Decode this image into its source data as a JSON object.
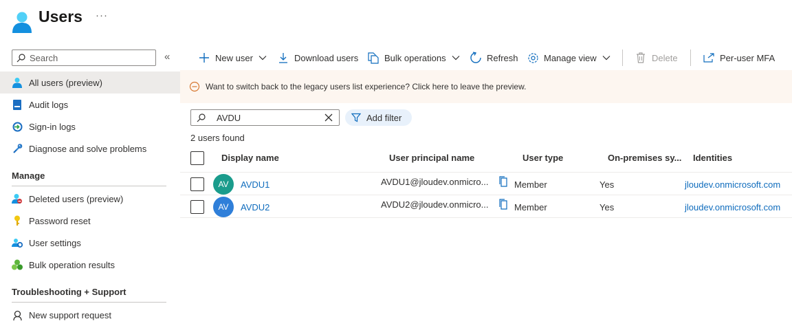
{
  "header": {
    "title": "Users",
    "more": "···"
  },
  "sidebar": {
    "search_placeholder": "Search",
    "collapse": "«",
    "items": [
      {
        "label": "All users (preview)"
      },
      {
        "label": "Audit logs"
      },
      {
        "label": "Sign-in logs"
      },
      {
        "label": "Diagnose and solve problems"
      }
    ],
    "manage_title": "Manage",
    "manage_items": [
      {
        "label": "Deleted users (preview)"
      },
      {
        "label": "Password reset"
      },
      {
        "label": "User settings"
      },
      {
        "label": "Bulk operation results"
      }
    ],
    "support_title": "Troubleshooting + Support",
    "support_items": [
      {
        "label": "New support request"
      }
    ]
  },
  "toolbar": {
    "new_user": "New user",
    "download_users": "Download users",
    "bulk_operations": "Bulk operations",
    "refresh": "Refresh",
    "manage_view": "Manage view",
    "delete": "Delete",
    "per_user_mfa": "Per-user MFA"
  },
  "banner": {
    "text": "Want to switch back to the legacy users list experience? Click here to leave the preview."
  },
  "filter": {
    "value": "AVDU",
    "add_filter": "Add filter",
    "results": "2 users found"
  },
  "table": {
    "columns": [
      "Display name",
      "User principal name",
      "User type",
      "On-premises sy...",
      "Identities"
    ],
    "rows": [
      {
        "initials": "AV",
        "display_name": "AVDU1",
        "upn": "AVDU1@jloudev.onmicro...",
        "user_type": "Member",
        "on_prem": "Yes",
        "identities": "jloudev.onmicrosoft.com",
        "avatar_color": "#1a9c8c"
      },
      {
        "initials": "AV",
        "display_name": "AVDU2",
        "upn": "AVDU2@jloudev.onmicro...",
        "user_type": "Member",
        "on_prem": "Yes",
        "identities": "jloudev.onmicrosoft.com",
        "avatar_color": "#2f7fd9"
      }
    ]
  },
  "colors": {
    "accent": "#0f6cbd",
    "banner_bg": "#fdf6f0",
    "active_nav": "#edebe9"
  }
}
